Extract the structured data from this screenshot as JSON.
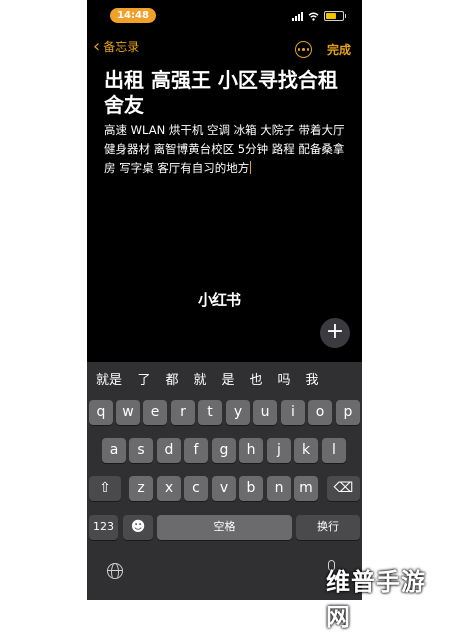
{
  "status_bar": {
    "time": "14:48"
  },
  "nav": {
    "back_label": "备忘录",
    "done_label": "完成"
  },
  "note": {
    "title": "出租 高强王 小区寻找合租舍友",
    "body": "高速 WLAN 烘干机 空调 冰箱 大院子 带着大厅 健身器材 离智博黄台校区 5分钟 路程 配备桑拿房 写字桌 客厅有自习的地方"
  },
  "watermark_brand": "小红书",
  "keyboard": {
    "candidates": [
      "就是",
      "了",
      "都",
      "就",
      "是",
      "也",
      "吗",
      "我"
    ],
    "row1": [
      "q",
      "w",
      "e",
      "r",
      "t",
      "y",
      "u",
      "i",
      "o",
      "p"
    ],
    "row2": [
      "a",
      "s",
      "d",
      "f",
      "g",
      "h",
      "j",
      "k",
      "l"
    ],
    "row3": [
      "z",
      "x",
      "c",
      "v",
      "b",
      "n",
      "m"
    ],
    "shift": "⇧",
    "delete": "⌫",
    "numbers": "123",
    "emoji": "☻",
    "space": "空格",
    "return": "换行"
  },
  "site_watermark": "维普手游网",
  "colors": {
    "accent": "#e3a21a",
    "time_pill": "#f1a02a",
    "keyboard_bg": "#303033",
    "key": "#6b6b6e"
  }
}
